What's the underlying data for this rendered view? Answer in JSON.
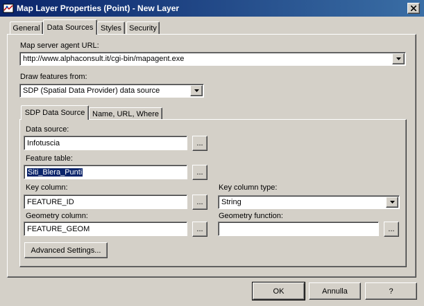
{
  "window": {
    "title": "Map Layer Properties (Point) - New Layer"
  },
  "tabs": [
    {
      "label": "General"
    },
    {
      "label": "Data Sources"
    },
    {
      "label": "Styles"
    },
    {
      "label": "Security"
    }
  ],
  "data_sources": {
    "agent_url_label": "Map server agent URL:",
    "agent_url_value": "http://www.alphaconsult.it/cgi-bin/mapagent.exe",
    "draw_from_label": "Draw features from:",
    "draw_from_value": "SDP (Spatial Data Provider) data source",
    "subtabs": [
      {
        "label": "SDP Data Source"
      },
      {
        "label": "Name, URL, Where"
      }
    ],
    "sdp": {
      "data_source_label": "Data source:",
      "data_source_value": "Infotuscia",
      "feature_table_label": "Feature table:",
      "feature_table_value": "Siti_Blera_Punti",
      "key_column_label": "Key column:",
      "key_column_value": "FEATURE_ID",
      "key_column_type_label": "Key column type:",
      "key_column_type_value": "String",
      "geometry_column_label": "Geometry column:",
      "geometry_column_value": "FEATURE_GEOM",
      "geometry_function_label": "Geometry function:",
      "geometry_function_value": "",
      "browse_label": "...",
      "advanced_label": "Advanced Settings..."
    }
  },
  "buttons": {
    "ok": "OK",
    "cancel": "Annulla",
    "help": "?"
  },
  "colors": {
    "title_start": "#0a246a",
    "title_end": "#3a6ea5",
    "face": "#d4d0c8",
    "selection": "#0a246a"
  }
}
